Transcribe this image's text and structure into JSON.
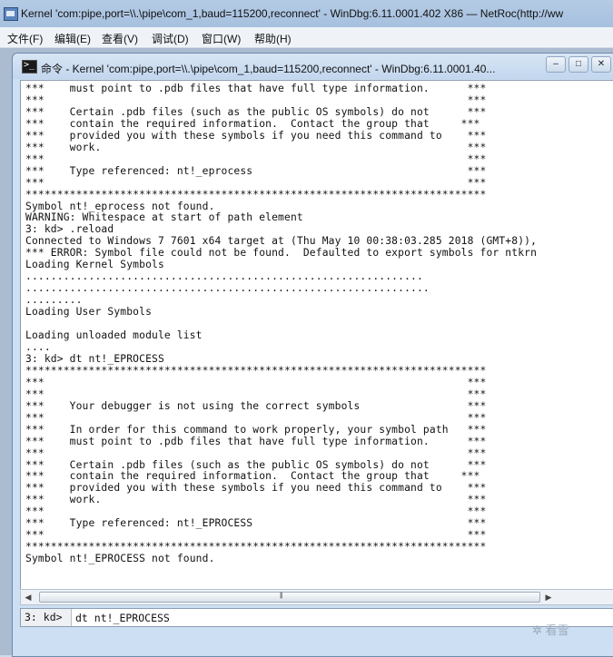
{
  "main_window": {
    "title": "Kernel 'com:pipe,port=\\\\.\\pipe\\com_1,baud=115200,reconnect' - WinDbg:6.11.0001.402 X86 — NetRoc(http://ww"
  },
  "menu": [
    "文件(F)",
    "编辑(E)",
    "查看(V)",
    "调试(D)",
    "窗口(W)",
    "帮助(H)"
  ],
  "command_window": {
    "title": "命令 - Kernel 'com:pipe,port=\\\\.\\pipe\\com_1,baud=115200,reconnect' - WinDbg:6.11.0001.40...",
    "output_lines": [
      "***    must point to .pdb files that have full type information.      ***",
      "***                                                                   ***",
      "***    Certain .pdb files (such as the public OS symbols) do not      ***",
      "***    contain the required information.  Contact the group that     ***",
      "***    provided you with these symbols if you need this command to    ***",
      "***    work.                                                          ***",
      "***                                                                   ***",
      "***    Type referenced: nt!_eprocess                                  ***",
      "***                                                                   ***",
      "*************************************************************************",
      "Symbol nt!_eprocess not found.",
      "WARNING: Whitespace at start of path element",
      "3: kd> .reload",
      "Connected to Windows 7 7601 x64 target at (Thu May 10 00:38:03.285 2018 (GMT+8)),",
      "*** ERROR: Symbol file could not be found.  Defaulted to export symbols for ntkrn",
      "Loading Kernel Symbols",
      "...............................................................",
      "................................................................",
      ".........",
      "Loading User Symbols",
      "",
      "Loading unloaded module list",
      "....",
      "3: kd> dt nt!_EPROCESS",
      "*************************************************************************",
      "***                                                                   ***",
      "***                                                                   ***",
      "***    Your debugger is not using the correct symbols                 ***",
      "***                                                                   ***",
      "***    In order for this command to work properly, your symbol path   ***",
      "***    must point to .pdb files that have full type information.      ***",
      "***                                                                   ***",
      "***    Certain .pdb files (such as the public OS symbols) do not      ***",
      "***    contain the required information.  Contact the group that     ***",
      "***    provided you with these symbols if you need this command to    ***",
      "***    work.                                                          ***",
      "***                                                                   ***",
      "***    Type referenced: nt!_EPROCESS                                  ***",
      "***                                                                   ***",
      "*************************************************************************",
      "Symbol nt!_EPROCESS not found."
    ],
    "prompt": "3: kd>",
    "input_value": "dt nt!_EPROCESS"
  },
  "watermark": "✲ 看雪"
}
